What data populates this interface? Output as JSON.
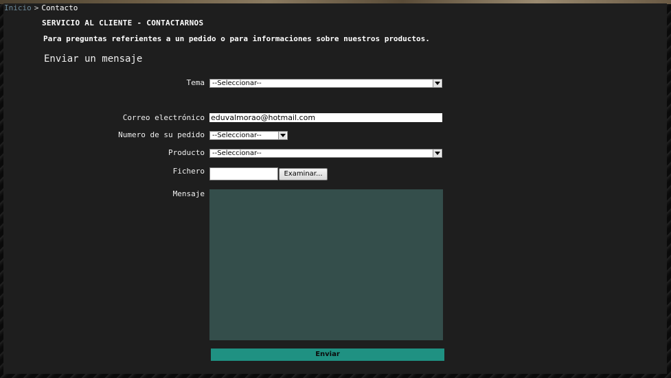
{
  "breadcrumb": {
    "home": "Inicio",
    "separator": ">",
    "current": "Contacto"
  },
  "page": {
    "section_title": "SERVICIO AL CLIENTE - CONTACTARNOS",
    "intro": "Para preguntas referientes a un pedido o para informaciones sobre nuestros productos.",
    "form_title": "Enviar un mensaje"
  },
  "form": {
    "topic": {
      "label": "Tema",
      "selected": "--Seleccionar--"
    },
    "email": {
      "label": "Correo electrónico",
      "value": "eduvalmorao@hotmail.com"
    },
    "order_number": {
      "label": "Numero de su pedido",
      "selected": "--Seleccionar--"
    },
    "product": {
      "label": "Producto",
      "selected": "--Seleccionar--"
    },
    "file": {
      "label": "Fichero",
      "browse_label": "Examinar..."
    },
    "message": {
      "label": "Mensaje"
    },
    "submit_label": "Enviar"
  },
  "colors": {
    "panel_background": "#1e1e1e",
    "message_area": "#344e4b",
    "submit_button": "#1f9182",
    "breadcrumb_link": "#6e8a9a"
  }
}
